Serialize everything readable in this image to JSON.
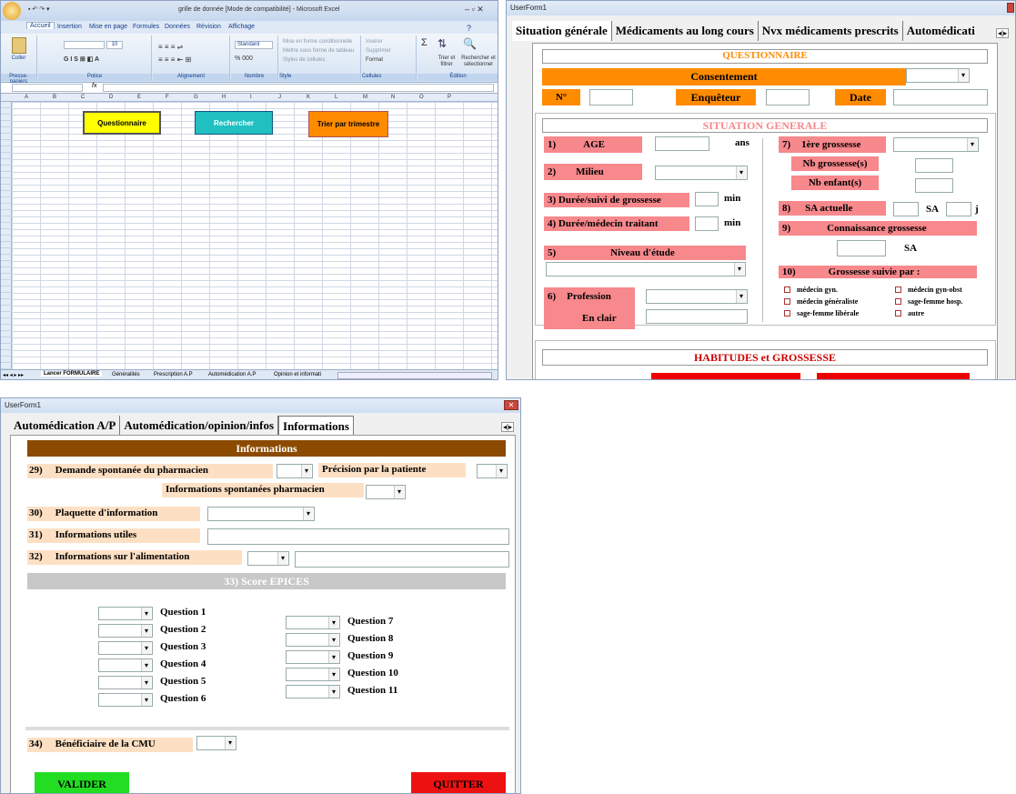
{
  "excel": {
    "title": "grille de donnée [Mode de compatibilité] - Microsoft Excel",
    "tabs": [
      "Accueil",
      "Insertion",
      "Mise en page",
      "Formules",
      "Données",
      "Révision",
      "Affichage"
    ],
    "groups": [
      "Presse-papiers",
      "Police",
      "Alignement",
      "Nombre",
      "Style",
      "Cellules",
      "Édition"
    ],
    "ribbon_labels": {
      "coller": "Coller",
      "font_size": "10",
      "standard": "Standard",
      "mise_forme_cond": "Mise en forme conditionnelle",
      "mettre_tableau": "Mettre sous forme de tableau",
      "styles_cellules": "Styles de cellules",
      "inserer": "Insérer",
      "supprimer": "Supprimer",
      "format": "Format",
      "trier": "Trier et filtrer",
      "rechercher": "Rechercher et sélectionner"
    },
    "formula_bar": {
      "name_box": "",
      "fx": "fx"
    },
    "columns": [
      "A",
      "B",
      "C",
      "D",
      "E",
      "F",
      "G",
      "H",
      "I",
      "J",
      "K",
      "L",
      "M",
      "N",
      "O",
      "P"
    ],
    "buttons": {
      "questionnaire": "Questionnaire",
      "rechercher": "Rechercher",
      "trier": "Trier par trimestre"
    },
    "sheets": [
      "Lancer FORMULAIRE",
      "Généralités",
      "Prescription A.P",
      "Automédication A.P",
      "Opinion et informati"
    ],
    "colors": {
      "questionnaire": "#ffff00",
      "rechercher": "#20c0c0",
      "trier": "#ff8c00"
    }
  },
  "uf1": {
    "title": "UserForm1",
    "tabs": [
      "Situation générale",
      "Médicaments au long cours",
      "Nvx médicaments prescrits",
      "Automédicati"
    ],
    "questionnaire": "QUESTIONNAIRE",
    "consentement": "Consentement",
    "no": "N°",
    "enqueteur": "Enquêteur",
    "date": "Date",
    "situation": "SITUATION GENERALE",
    "q1": "1)",
    "age": "AGE",
    "ans": "ans",
    "q2": "2)",
    "milieu": "Milieu",
    "q3": "3) Durée/suivi de grossesse",
    "min": "min",
    "q4": "4) Durée/médecin traitant",
    "q5": "5)",
    "niveau": "Niveau d'étude",
    "q6": "6)",
    "profession": "Profession",
    "enclair": "En clair",
    "q7": "7)",
    "premiere": "1ère grossesse",
    "nbgross": "Nb grossesse(s)",
    "nbenf": "Nb enfant(s)",
    "q8": "8)",
    "sa_actuelle": "SA actuelle",
    "sa": "SA",
    "j": "j",
    "q9": "9)",
    "connaissance": "Connaissance grossesse",
    "q10": "10)",
    "suivie": "Grossesse suivie par :",
    "checks": [
      "médecin gyn.",
      "médecin généraliste",
      "sage-femme libérale",
      "médecin gyn-obst",
      "sage-femme hosp.",
      "autre"
    ],
    "habitudes": "HABITUDES et GROSSESSE"
  },
  "uf2": {
    "title": "UserForm1",
    "tabs": [
      "Automédication A/P",
      "Automédication/opinion/infos",
      "Informations"
    ],
    "informations": "Informations",
    "q29": "29)",
    "demande": "Demande spontanée du pharmacien",
    "precision": "Précision par la patiente",
    "infos_spont": "Informations spontanées pharmacien",
    "q30": "30)",
    "plaquette": "Plaquette d'information",
    "q31": "31)",
    "utiles": "Informations utiles",
    "q32": "32)",
    "alimentation": "Informations sur l'alimentation",
    "score": "33) Score EPICES",
    "questions_left": [
      "Question 1",
      "Question 2",
      "Question 3",
      "Question 4",
      "Question 5",
      "Question 6"
    ],
    "questions_right": [
      "Question 7",
      "Question 8",
      "Question 9",
      "Question 10",
      "Question 11"
    ],
    "q34": "34)",
    "cmu": "Bénéficiaire de la CMU",
    "valider": "VALIDER",
    "quitter": "QUITTER"
  }
}
